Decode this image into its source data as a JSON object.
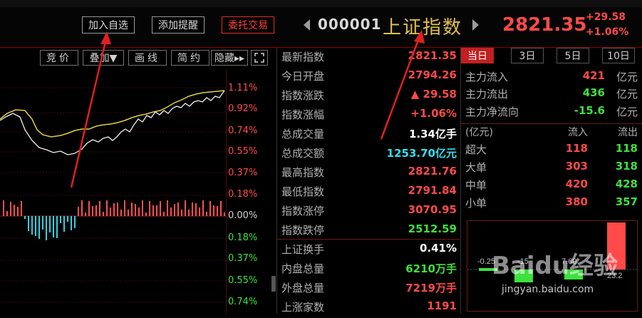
{
  "header": {
    "buttons": {
      "add_watch": "加入自选",
      "add_alert": "添加提醒",
      "trade": "委托交易"
    },
    "code": "000001",
    "name": "上证指数",
    "price": "2821.35",
    "change": "+29.58",
    "change_pct": "+1.06%"
  },
  "toolbar": {
    "bid": "竞价",
    "overlay": "叠加▼",
    "draw": "画线",
    "simple": "简约",
    "hide": "隐藏▸▸",
    "expand_icon": "expand-icon"
  },
  "chart_axis": {
    "price_pct": [
      "1.11%",
      "0.92%",
      "0.74%",
      "0.55%",
      "0.37%",
      "0.18%",
      "0.00%",
      "0.18%",
      "0.37%",
      "0.55%",
      "0.74%"
    ]
  },
  "quote": {
    "rows": [
      {
        "label": "最新指数",
        "value": "2821.35"
      },
      {
        "label": "今日开盘",
        "value": "2794.26"
      },
      {
        "label": "指数涨跌",
        "value": "▲ 29.58"
      },
      {
        "label": "指数涨幅",
        "value": "+1.06%"
      },
      {
        "label": "总成交量",
        "value": "1.34亿手"
      },
      {
        "label": "总成交额",
        "value": "1253.70亿元"
      },
      {
        "label": "最高指数",
        "value": "2821.76"
      },
      {
        "label": "最低指数",
        "value": "2791.84"
      },
      {
        "label": "指数涨停",
        "value": "3070.95"
      },
      {
        "label": "指数跌停",
        "value": "2512.59"
      },
      {
        "label": "上证换手",
        "value": "0.41%"
      },
      {
        "label": "内盘总量",
        "value": "6210万手"
      },
      {
        "label": "外盘总量",
        "value": "7219万手"
      },
      {
        "label": "上涨家数",
        "value": "1191"
      }
    ]
  },
  "fundflow": {
    "tabs": [
      "当日",
      "3日",
      "5日",
      "10日"
    ],
    "summary": [
      {
        "label": "主力流入",
        "value": "421",
        "unit": "亿元"
      },
      {
        "label": "主力流出",
        "value": "436",
        "unit": "亿元"
      },
      {
        "label": "主力净流向",
        "value": "-15.6",
        "unit": "亿元"
      }
    ],
    "header": {
      "unit": "(亿元)",
      "in": "流入",
      "out": "流出"
    },
    "rows": [
      {
        "name": "超大",
        "in": "118",
        "out": "118"
      },
      {
        "name": "大单",
        "in": "303",
        "out": "318"
      },
      {
        "name": "中单",
        "in": "420",
        "out": "428"
      },
      {
        "name": "小单",
        "in": "380",
        "out": "357"
      }
    ],
    "bar_labels": [
      "-0.25",
      "-15",
      "7.60",
      "23.2"
    ]
  },
  "watermark": {
    "brand": "Baidu经验",
    "url": "jingyan.baidu.com"
  },
  "colors": {
    "up": "#ff4a4a",
    "down": "#3ee03e",
    "index_name": "#e0c050",
    "cyan": "#33e0f0"
  }
}
